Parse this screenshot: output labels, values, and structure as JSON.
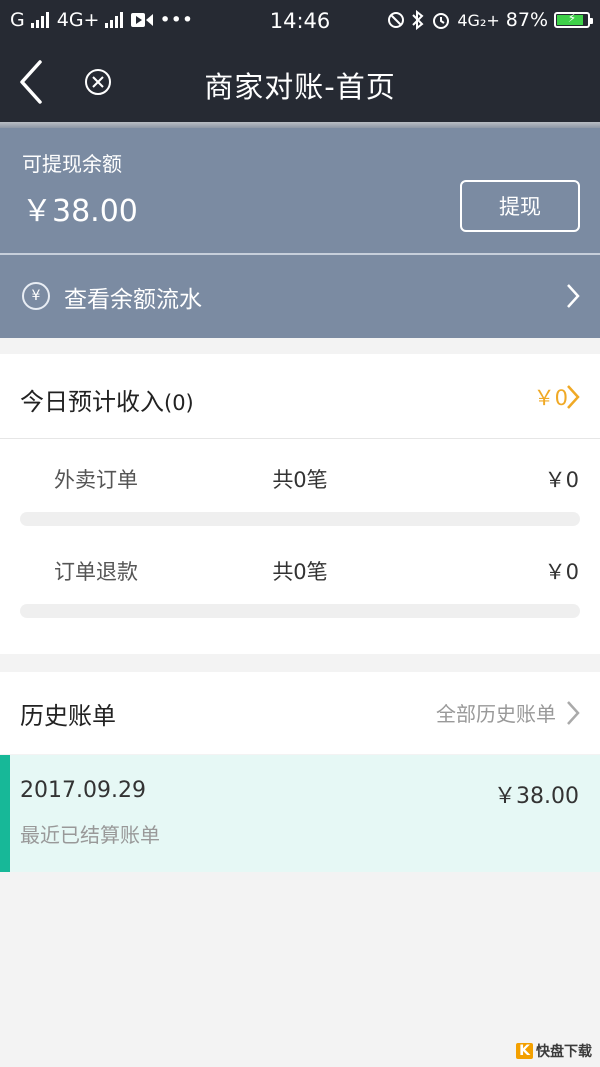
{
  "status_bar": {
    "carrier_left": "G",
    "network": "4G+",
    "more": "•••",
    "time": "14:46",
    "network_right": "4G₂+",
    "battery_percent": "87%",
    "battery_level": 0.87
  },
  "nav": {
    "title": "商家对账-首页"
  },
  "balance": {
    "label": "可提现余额",
    "value": "￥38.00",
    "withdraw_label": "提现"
  },
  "flow": {
    "icon_glyph": "¥",
    "label": "查看余额流水"
  },
  "today": {
    "title": "今日预计收入",
    "count": "(0)",
    "amount": "￥0",
    "rows": [
      {
        "label": "外卖订单",
        "count": "共0笔",
        "amount": "￥0"
      },
      {
        "label": "订单退款",
        "count": "共0笔",
        "amount": "￥0"
      }
    ]
  },
  "history": {
    "title": "历史账单",
    "link": "全部历史账单",
    "bill": {
      "date": "2017.09.29",
      "amount": "￥38.00",
      "subtitle": "最近已结算账单"
    }
  },
  "watermark": {
    "text": "快盘下载"
  },
  "colors": {
    "header_bg": "#262a33",
    "balance_bg": "#7b8ba2",
    "accent_orange": "#f0a925",
    "accent_green": "#17b898",
    "bill_bg": "#e6f8f5"
  }
}
